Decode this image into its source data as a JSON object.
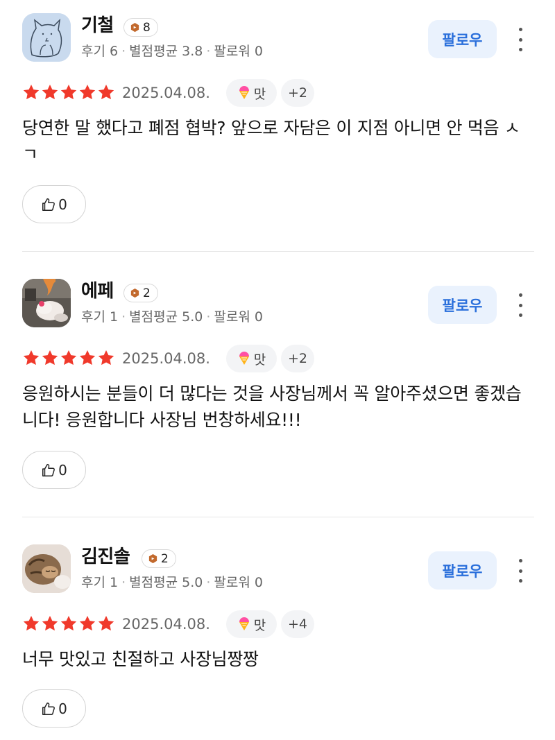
{
  "reviews": [
    {
      "name": "기철",
      "badge_count": "8",
      "meta": {
        "reviews": "후기 6",
        "avg": "별점평균 3.8",
        "followers": "팔로워 0"
      },
      "follow_label": "팔로우",
      "rating": 5,
      "date": "2025.04.08.",
      "tag": "맛",
      "more_tags": "+2",
      "text": "당연한 말 했다고 폐점 협박? 앞으로 자담은 이 지점 아니면 안 먹음 ㅅㄱ",
      "likes": "0",
      "avatar": "cat-drawing"
    },
    {
      "name": "에페",
      "badge_count": "2",
      "meta": {
        "reviews": "후기 1",
        "avg": "별점평균 5.0",
        "followers": "팔로워 0"
      },
      "follow_label": "팔로우",
      "rating": 5,
      "date": "2025.04.08.",
      "tag": "맛",
      "more_tags": "+2",
      "text": "응원하시는 분들이 더 많다는 것을 사장님께서 꼭 알아주셨으면 좋겠습니다! 응원합니다 사장님 번창하세요!!!",
      "likes": "0",
      "avatar": "plush-toy-photo"
    },
    {
      "name": "김진솔",
      "badge_count": "2",
      "meta": {
        "reviews": "후기 1",
        "avg": "별점평균 5.0",
        "followers": "팔로워 0"
      },
      "follow_label": "팔로우",
      "rating": 5,
      "date": "2025.04.08.",
      "tag": "맛",
      "more_tags": "+4",
      "text": "너무 맛있고 친절하고 사장님짱짱",
      "likes": "0",
      "avatar": "sleeping-cat-photo"
    }
  ],
  "colors": {
    "star": "#f0392b",
    "follow_bg": "#eaf2fd",
    "follow_text": "#2a6fdb",
    "badge_icon": "#c2692d"
  }
}
